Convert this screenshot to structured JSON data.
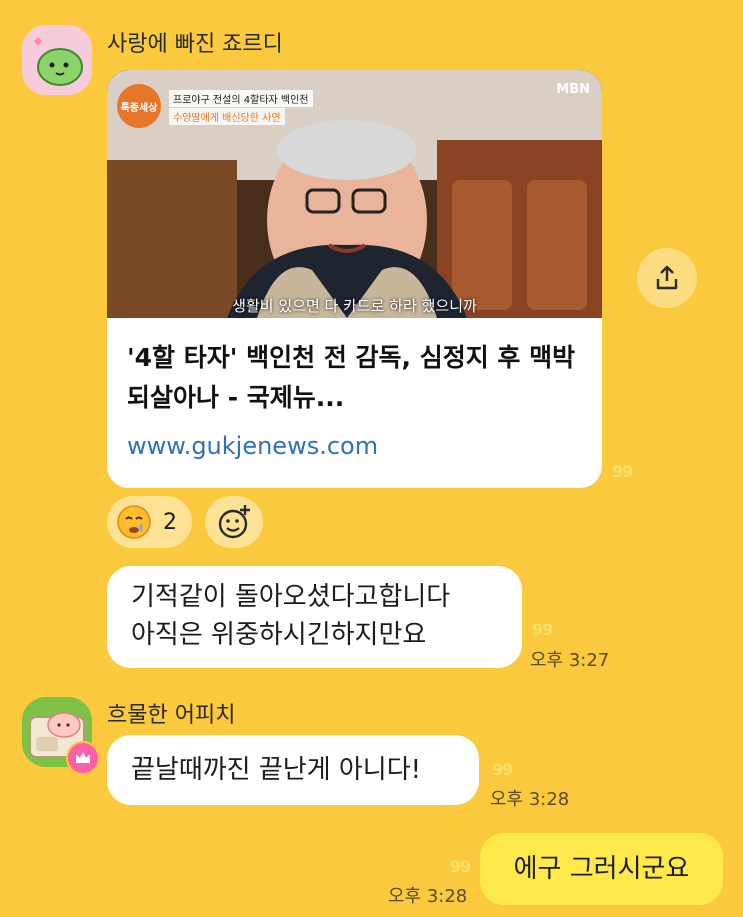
{
  "messages": {
    "sender1": {
      "name": "사랑에 빠진 죠르디"
    },
    "link_card": {
      "thumb_tag": "프로야구 전설의 4할타자 백인천",
      "thumb_sub": "수양딸에게 배신당한 사연",
      "thumb_badge": "특종세상",
      "thumb_channel": "MBN",
      "thumb_caption": "생활비 있으면 다 카드로 하라 했으니까",
      "title": "'4할 타자' 백인천 전 감독, 심정지 후 맥박 되살아나 - 국제뉴...",
      "url": "www.gukjenews.com",
      "unread": "99"
    },
    "reaction": {
      "count": "2"
    },
    "msg1": {
      "line1": "기적같이 돌아오셨다고합니다",
      "line2": "아직은 위중하시긴하지만요",
      "unread": "99",
      "time": "오후 3:27"
    },
    "sender2": {
      "name": "흐물한 어피치"
    },
    "msg2": {
      "text": "끝날때까진 끝난게 아니다!",
      "unread": "99",
      "time": "오후 3:28"
    },
    "msg3": {
      "text": "에구 그러시군요",
      "unread": "99",
      "time": "오후 3:28"
    }
  },
  "colors": {
    "background": "#fbc93d",
    "my_bubble": "#ffe94a",
    "link": "#2f6fbe"
  },
  "icons": [
    "share-icon",
    "emoji-add-icon",
    "crying-emoji-icon",
    "crown-icon"
  ]
}
